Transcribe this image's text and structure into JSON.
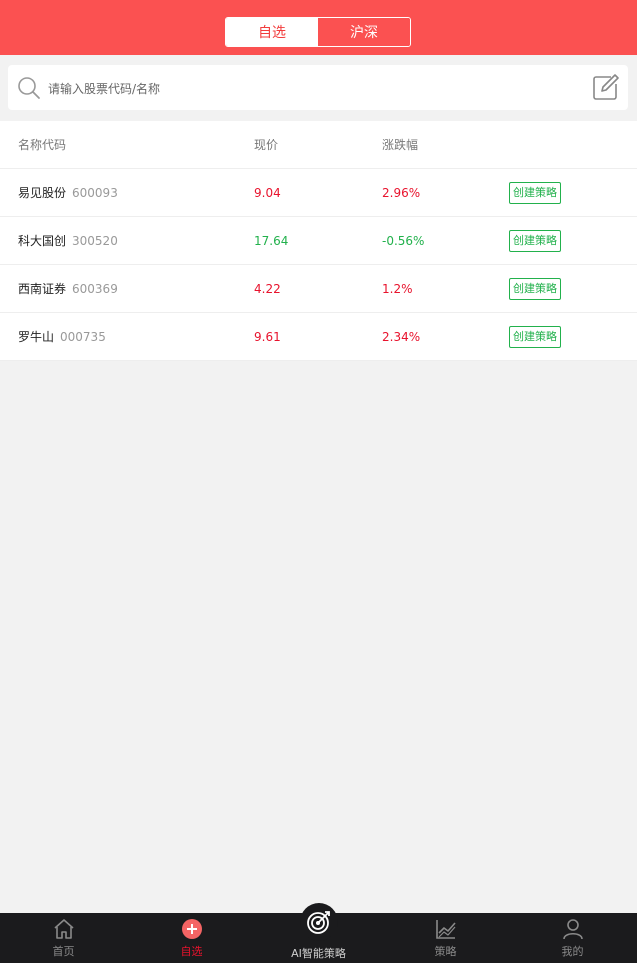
{
  "header": {
    "tabs": [
      {
        "label": "自选",
        "active": true
      },
      {
        "label": "沪深",
        "active": false
      }
    ],
    "bg_color": "#fb5151"
  },
  "search": {
    "placeholder": "请输入股票代码/名称",
    "value": ""
  },
  "table": {
    "columns": [
      "名称代码",
      "现价",
      "涨跌幅"
    ],
    "rows": [
      {
        "name": "易见股份",
        "code": "600093",
        "price": "9.04",
        "change": "2.96%",
        "direction": "up",
        "action": "创建策略"
      },
      {
        "name": "科大国创",
        "code": "300520",
        "price": "17.64",
        "change": "-0.56%",
        "direction": "down",
        "action": "创建策略"
      },
      {
        "name": "西南证券",
        "code": "600369",
        "price": "4.22",
        "change": "1.2%",
        "direction": "up",
        "action": "创建策略"
      },
      {
        "name": "罗牛山",
        "code": "000735",
        "price": "9.61",
        "change": "2.34%",
        "direction": "up",
        "action": "创建策略"
      }
    ]
  },
  "tabbar": {
    "items": [
      {
        "label": "首页",
        "icon": "home-icon",
        "active": false
      },
      {
        "label": "自选",
        "icon": "plus-circle-icon",
        "active": true
      },
      {
        "label": "AI智能策略",
        "icon": "target-icon",
        "active": false
      },
      {
        "label": "策略",
        "icon": "chart-icon",
        "active": false
      },
      {
        "label": "我的",
        "icon": "user-icon",
        "active": false
      }
    ]
  },
  "colors": {
    "up": "#e8132d",
    "down": "#22b14c",
    "accent": "#fb5151"
  }
}
